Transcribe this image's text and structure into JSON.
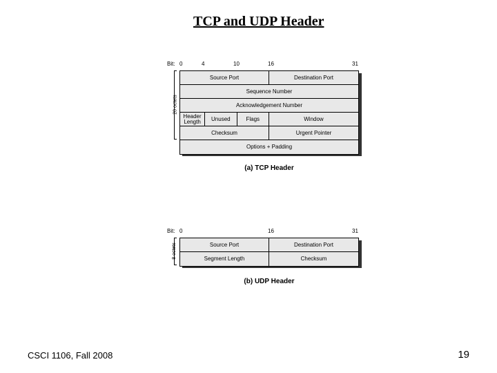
{
  "title": "TCP and UDP Header",
  "footer": {
    "course": "CSCI 1106, Fall 2008",
    "page": "19"
  },
  "tcp": {
    "bit_label": "Bit:",
    "bits": [
      "0",
      "4",
      "10",
      "16",
      "31"
    ],
    "side": "20 octets",
    "rows": {
      "src": "Source Port",
      "dst": "Destination Port",
      "seq": "Sequence Number",
      "ack": "Acknowledgement Number",
      "hlen": "Header Length",
      "unused": "Unused",
      "flags": "Flags",
      "window": "Window",
      "chk": "Checksum",
      "urg": "Urgent Pointer",
      "opt": "Options + Padding"
    },
    "caption": "(a) TCP Header"
  },
  "udp": {
    "bit_label": "Bit:",
    "bits": [
      "0",
      "16",
      "31"
    ],
    "side": "8 octets",
    "rows": {
      "src": "Source Port",
      "dst": "Destination Port",
      "len": "Segment Length",
      "chk": "Checksum"
    },
    "caption": "(b) UDP Header"
  }
}
